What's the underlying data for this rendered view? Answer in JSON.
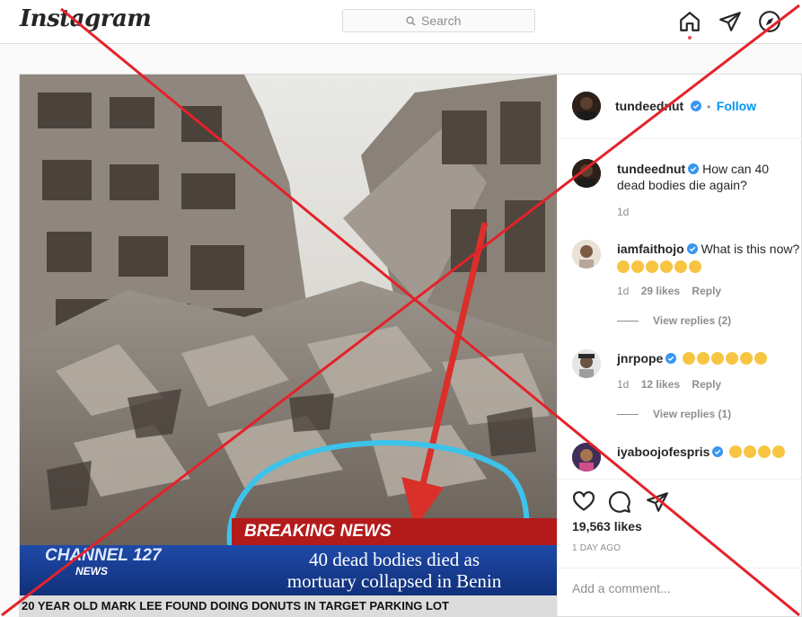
{
  "nav": {
    "logo": "Instagram",
    "search_placeholder": "Search"
  },
  "post": {
    "author": "tundeednut",
    "follow_label": "Follow",
    "image": {
      "breaking_news": "BREAKING NEWS",
      "headline_line1": "40 dead bodies died as",
      "headline_line2": "mortuary collapsed in Benin",
      "channel": "CHANNEL 127",
      "channel_sub": "NEWS",
      "ticker": "20 YEAR OLD MARK LEE FOUND DOING DONUTS IN TARGET PARKING LOT"
    },
    "comments": [
      {
        "user": "tundeednut",
        "text": "How can 40 dead bodies die again?",
        "time": "1d"
      },
      {
        "user": "iamfaithojo",
        "text": "What is this now?",
        "time": "1d",
        "likes": "29 likes",
        "reply_label": "Reply",
        "view_replies": "View replies (2)"
      },
      {
        "user": "jnrpope",
        "time": "1d",
        "likes": "12 likes",
        "reply_label": "Reply",
        "view_replies": "View replies (1)"
      },
      {
        "user": "iyaboojofespris"
      }
    ],
    "likes_count": "19,563 likes",
    "posted_ago": "1 DAY AGO",
    "add_comment_placeholder": "Add a comment..."
  },
  "icons": {
    "home": "home-icon",
    "direct": "paper-plane-icon",
    "explore": "compass-icon",
    "like": "heart-icon",
    "comment": "comment-icon",
    "share": "share-icon",
    "verified": "verified-badge-icon"
  },
  "colors": {
    "link_blue": "#0095f6",
    "verified_blue": "#3897f0",
    "cross_red": "#e4222a",
    "notification_dot": "#ed4956"
  }
}
